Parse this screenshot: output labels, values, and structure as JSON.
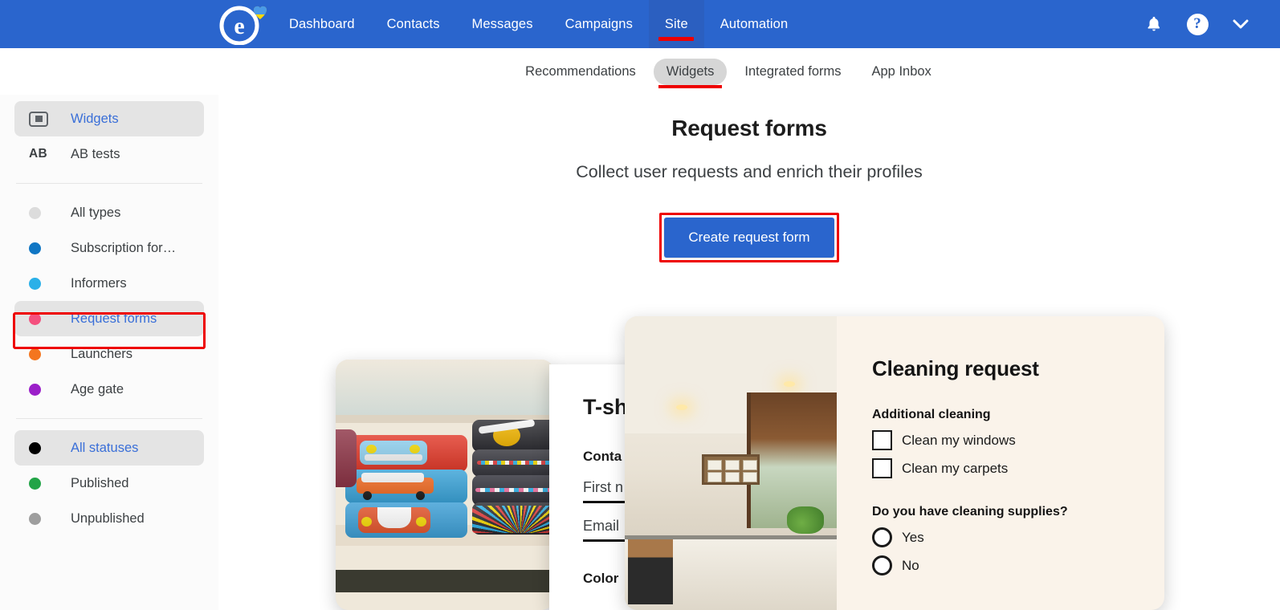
{
  "topnav": {
    "logo_name": "esputnik-logo",
    "links": [
      {
        "label": "Dashboard",
        "active": false
      },
      {
        "label": "Contacts",
        "active": false
      },
      {
        "label": "Messages",
        "active": false
      },
      {
        "label": "Campaigns",
        "active": false
      },
      {
        "label": "Site",
        "active": true
      },
      {
        "label": "Automation",
        "active": false
      }
    ],
    "icons": [
      "bell-icon",
      "help-icon",
      "chevron-down-icon"
    ],
    "background_color": "#2a65cd",
    "active_background_color": "#2b5fc0",
    "annotation_color": "#ee0000"
  },
  "subtabs": [
    {
      "label": "Recommendations",
      "active": false
    },
    {
      "label": "Widgets",
      "active": true
    },
    {
      "label": "Integrated forms",
      "active": false
    },
    {
      "label": "App Inbox",
      "active": false
    }
  ],
  "sidebar": {
    "top_items": [
      {
        "label": "Widgets",
        "icon": "widget-icon",
        "selected": true
      },
      {
        "label": "AB tests",
        "icon": "ab-icon",
        "selected": false
      }
    ],
    "types": [
      {
        "label": "All types",
        "color": "#dcdcdc",
        "selected": false,
        "annotated": false
      },
      {
        "label": "Subscription for…",
        "color": "#1076c4",
        "selected": false,
        "annotated": false
      },
      {
        "label": "Informers",
        "color": "#2ab0e8",
        "selected": false,
        "annotated": false
      },
      {
        "label": "Request forms",
        "color": "#f4507e",
        "selected": true,
        "annotated": true
      },
      {
        "label": "Launchers",
        "color": "#f4761f",
        "selected": false,
        "annotated": false
      },
      {
        "label": "Age gate",
        "color": "#9b1fc9",
        "selected": false,
        "annotated": false
      }
    ],
    "statuses": [
      {
        "label": "All statuses",
        "color": "#000000",
        "selected": true
      },
      {
        "label": "Published",
        "color": "#22a447",
        "selected": false
      },
      {
        "label": "Unpublished",
        "color": "#9e9e9e",
        "selected": false
      }
    ]
  },
  "main": {
    "title": "Request forms",
    "subtitle": "Collect user requests and enrich their profiles",
    "cta_label": "Create request form",
    "cta_color": "#2a65cd"
  },
  "cards": {
    "tshirt_form": {
      "title": "T-sh",
      "section": "Conta",
      "field_first_name": "First n",
      "field_email": "Email",
      "section_color": "Color"
    },
    "cleaning_form": {
      "title": "Cleaning request",
      "section_additional": "Additional cleaning",
      "checkboxes": [
        {
          "label": "Clean my windows",
          "checked": false
        },
        {
          "label": "Clean my carpets",
          "checked": false
        }
      ],
      "question": "Do you have cleaning supplies?",
      "radios": [
        {
          "label": "Yes",
          "checked": false
        },
        {
          "label": "No",
          "checked": false
        }
      ],
      "background_color": "#faf3ea"
    }
  }
}
